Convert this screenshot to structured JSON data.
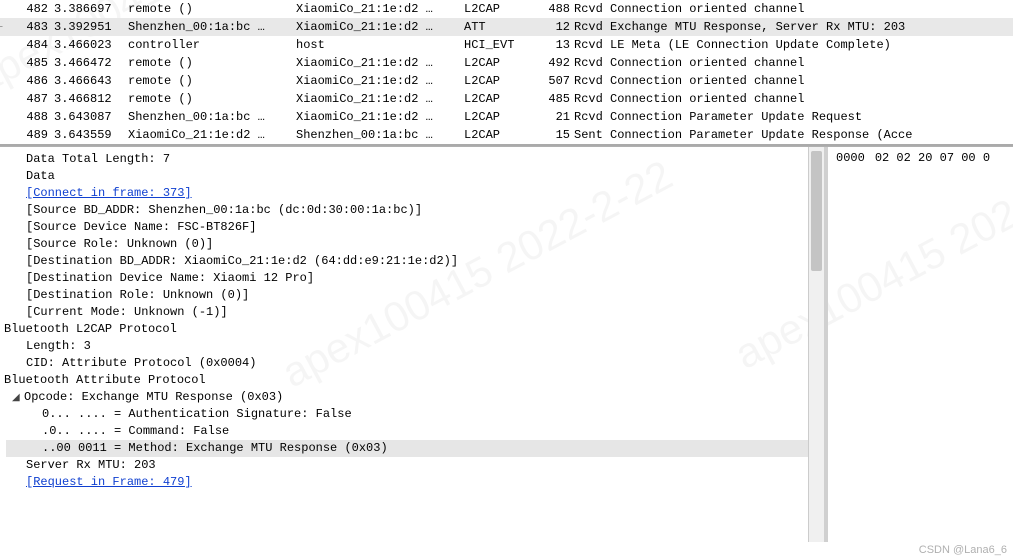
{
  "packets": [
    {
      "no": "482",
      "time": "3.386697",
      "src": "remote ()",
      "dst": "XiaomiCo_21:1e:d2 …",
      "proto": "L2CAP",
      "len": "488",
      "info": "Rcvd Connection oriented channel",
      "sel": false
    },
    {
      "no": "483",
      "time": "3.392951",
      "src": "Shenzhen_00:1a:bc …",
      "dst": "XiaomiCo_21:1e:d2 …",
      "proto": "ATT",
      "len": "12",
      "info": "Rcvd Exchange MTU Response, Server Rx MTU: 203",
      "sel": true
    },
    {
      "no": "484",
      "time": "3.466023",
      "src": "controller",
      "dst": "host",
      "proto": "HCI_EVT",
      "len": "13",
      "info": "Rcvd LE Meta (LE Connection Update Complete)",
      "sel": false
    },
    {
      "no": "485",
      "time": "3.466472",
      "src": "remote ()",
      "dst": "XiaomiCo_21:1e:d2 …",
      "proto": "L2CAP",
      "len": "492",
      "info": "Rcvd Connection oriented channel",
      "sel": false
    },
    {
      "no": "486",
      "time": "3.466643",
      "src": "remote ()",
      "dst": "XiaomiCo_21:1e:d2 …",
      "proto": "L2CAP",
      "len": "507",
      "info": "Rcvd Connection oriented channel",
      "sel": false
    },
    {
      "no": "487",
      "time": "3.466812",
      "src": "remote ()",
      "dst": "XiaomiCo_21:1e:d2 …",
      "proto": "L2CAP",
      "len": "485",
      "info": "Rcvd Connection oriented channel",
      "sel": false
    },
    {
      "no": "488",
      "time": "3.643087",
      "src": "Shenzhen_00:1a:bc …",
      "dst": "XiaomiCo_21:1e:d2 …",
      "proto": "L2CAP",
      "len": "21",
      "info": "Rcvd Connection Parameter Update Request",
      "sel": false
    },
    {
      "no": "489",
      "time": "3.643559",
      "src": "XiaomiCo_21:1e:d2 …",
      "dst": "Shenzhen_00:1a:bc …",
      "proto": "L2CAP",
      "len": "15",
      "info": "Sent Connection Parameter Update Response (Acce",
      "sel": false
    }
  ],
  "tree": {
    "data_total_length": "Data Total Length: 7",
    "data_label": "Data",
    "connect_frame": "[Connect in frame: 373]",
    "src_bdaddr": "[Source BD_ADDR: Shenzhen_00:1a:bc (dc:0d:30:00:1a:bc)]",
    "src_devname": "[Source Device Name: FSC-BT826F]",
    "src_role": "[Source Role: Unknown (0)]",
    "dst_bdaddr": "[Destination BD_ADDR: XiaomiCo_21:1e:d2 (64:dd:e9:21:1e:d2)]",
    "dst_devname": "[Destination Device Name: Xiaomi 12 Pro]",
    "dst_role": "[Destination Role: Unknown (0)]",
    "cur_mode": "[Current Mode: Unknown (-1)]",
    "l2cap_hdr": "Bluetooth L2CAP Protocol",
    "l2cap_len": "Length: 3",
    "l2cap_cid": "CID: Attribute Protocol (0x0004)",
    "att_hdr": "Bluetooth Attribute Protocol",
    "opcode": "Opcode: Exchange MTU Response (0x03)",
    "authsig": "0... .... = Authentication Signature: False",
    "command": ".0.. .... = Command: False",
    "method": "..00 0011 = Method: Exchange MTU Response (0x03)",
    "server_mtu": "Server Rx MTU: 203",
    "req_frame": "[Request in Frame: 479]"
  },
  "hex": {
    "offset": "0000",
    "bytes": "02 02 20 07 00 0"
  },
  "watermark": "CSDN @Lana6_6"
}
